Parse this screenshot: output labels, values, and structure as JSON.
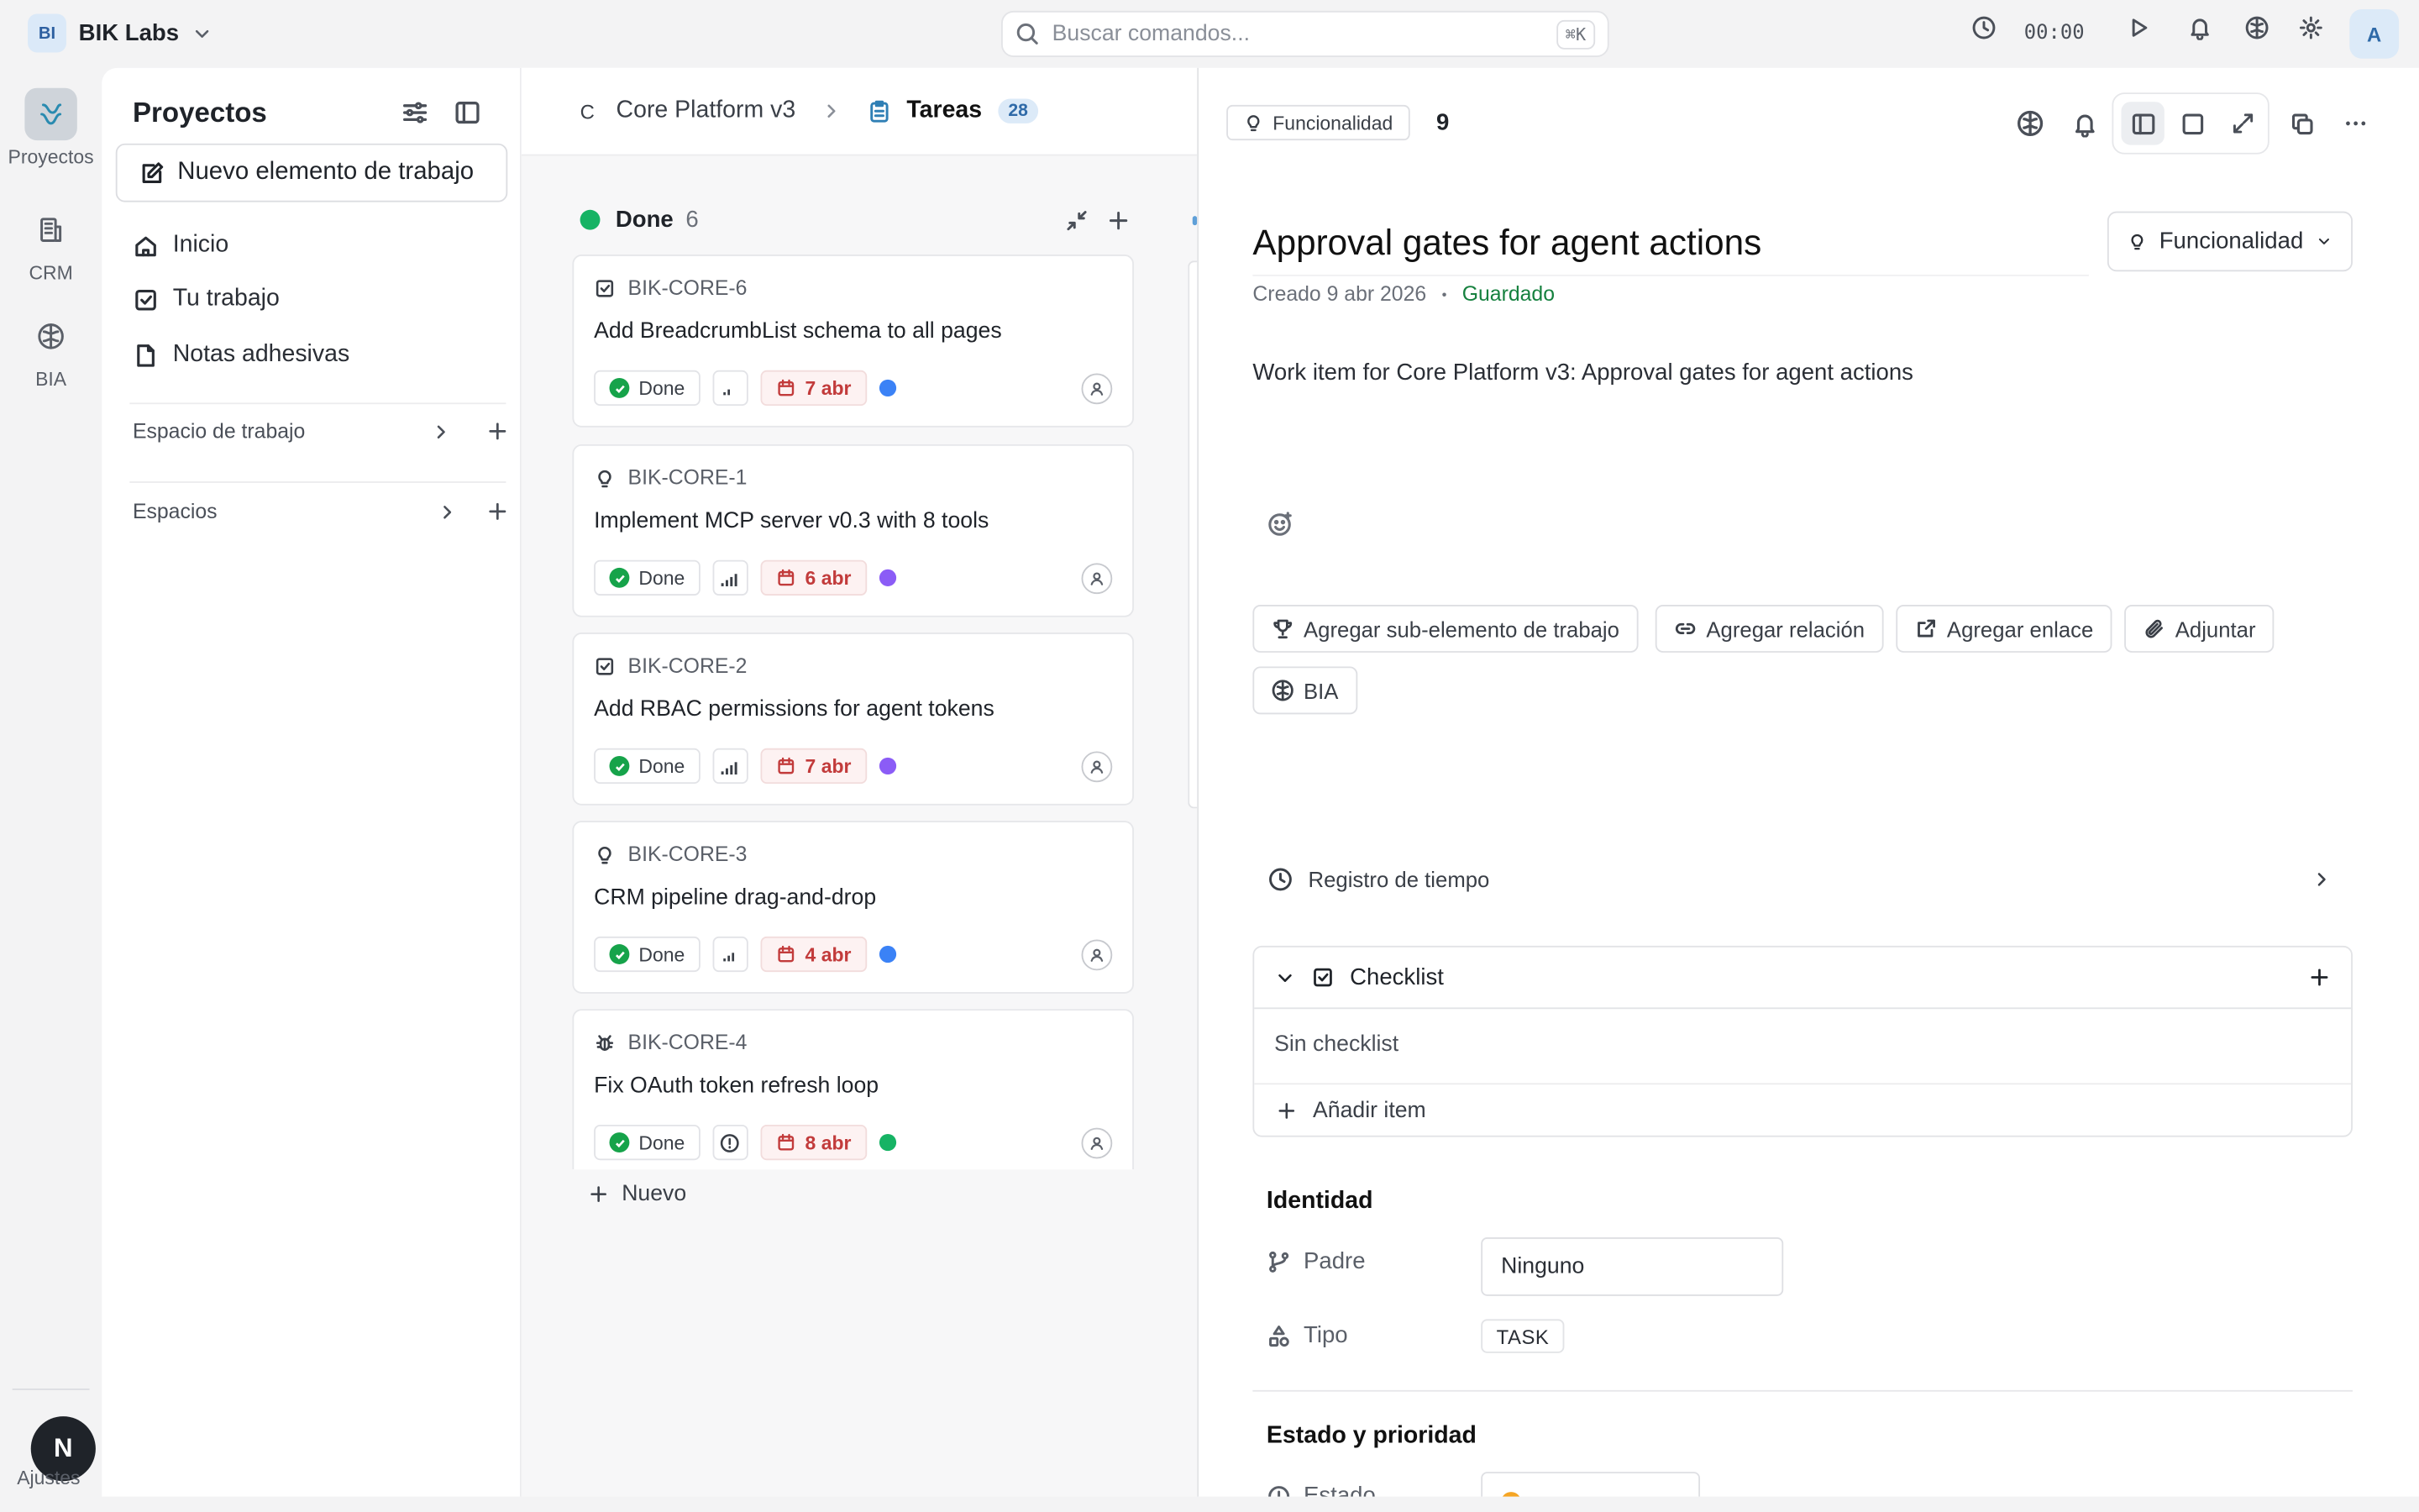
{
  "topbar": {
    "workspace_badge": "BI",
    "workspace_name": "BIK Labs",
    "search_placeholder": "Buscar comandos...",
    "search_shortcut": "⌘K",
    "timer": "00:00",
    "user_initial": "A"
  },
  "rail": {
    "items": [
      {
        "label": "Proyectos",
        "icon": "projects-icon"
      },
      {
        "label": "CRM",
        "icon": "crm-icon"
      },
      {
        "label": "BIA",
        "icon": "brain-icon"
      }
    ],
    "app_logo": "N",
    "settings_label": "Ajustes"
  },
  "sidebar": {
    "title": "Proyectos",
    "new_work_item": "Nuevo elemento de trabajo",
    "nav": [
      {
        "label": "Inicio",
        "icon": "home-icon"
      },
      {
        "label": "Tu trabajo",
        "icon": "check-square-icon"
      },
      {
        "label": "Notas adhesivas",
        "icon": "note-icon"
      }
    ],
    "sections": [
      "Espacio de trabajo",
      "Espacios"
    ]
  },
  "board": {
    "project_initial": "C",
    "project_name": "Core Platform v3",
    "view_name": "Tareas",
    "task_count": "28",
    "column": {
      "name": "Done",
      "count": "6",
      "color": "#16b364"
    },
    "cards": [
      {
        "id": "BIK-CORE-6",
        "type_icon": "task-icon",
        "title": "Add BreadcrumbList schema to all pages",
        "status": "Done",
        "priority_icon": "priority-low-icon",
        "date": "7 abr",
        "dot": "#3b82f6"
      },
      {
        "id": "BIK-CORE-1",
        "type_icon": "bulb-icon",
        "title": "Implement MCP server v0.3 with 8 tools",
        "status": "Done",
        "priority_icon": "priority-high-icon",
        "date": "6 abr",
        "dot": "#8b5cf6"
      },
      {
        "id": "BIK-CORE-2",
        "type_icon": "task-icon",
        "title": "Add RBAC permissions for agent tokens",
        "status": "Done",
        "priority_icon": "priority-high-icon",
        "date": "7 abr",
        "dot": "#8b5cf6"
      },
      {
        "id": "BIK-CORE-3",
        "type_icon": "bulb-icon",
        "title": "CRM pipeline drag-and-drop",
        "status": "Done",
        "priority_icon": "priority-medium-icon",
        "date": "4 abr",
        "dot": "#3b82f6"
      },
      {
        "id": "BIK-CORE-4",
        "type_icon": "bug-icon",
        "title": "Fix OAuth token refresh loop",
        "status": "Done",
        "priority_icon": "priority-urgent-icon",
        "date": "8 abr",
        "dot": "#16b364"
      }
    ],
    "new_label": "Nuevo"
  },
  "detail": {
    "type_pill": "Funcionalidad",
    "number": "9",
    "title": "Approval gates for agent actions",
    "type_select": "Funcionalidad",
    "created": "Creado 9 abr 2026",
    "separator": "•",
    "saved": "Guardado",
    "description": "Work item for Core Platform v3: Approval gates for agent actions",
    "actions": [
      "Agregar sub-elemento de trabajo",
      "Agregar relación",
      "Agregar enlace",
      "Adjuntar",
      "BIA"
    ],
    "time_log": "Registro de tiempo",
    "checklist": {
      "title": "Checklist",
      "empty": "Sin checklist",
      "add": "Añadir item"
    },
    "identity": {
      "heading": "Identidad",
      "parent_label": "Padre",
      "parent_value": "Ninguno",
      "type_label": "Tipo",
      "type_value": "TASK"
    },
    "state_priority": {
      "heading": "Estado y prioridad",
      "state_label": "Estado"
    }
  }
}
